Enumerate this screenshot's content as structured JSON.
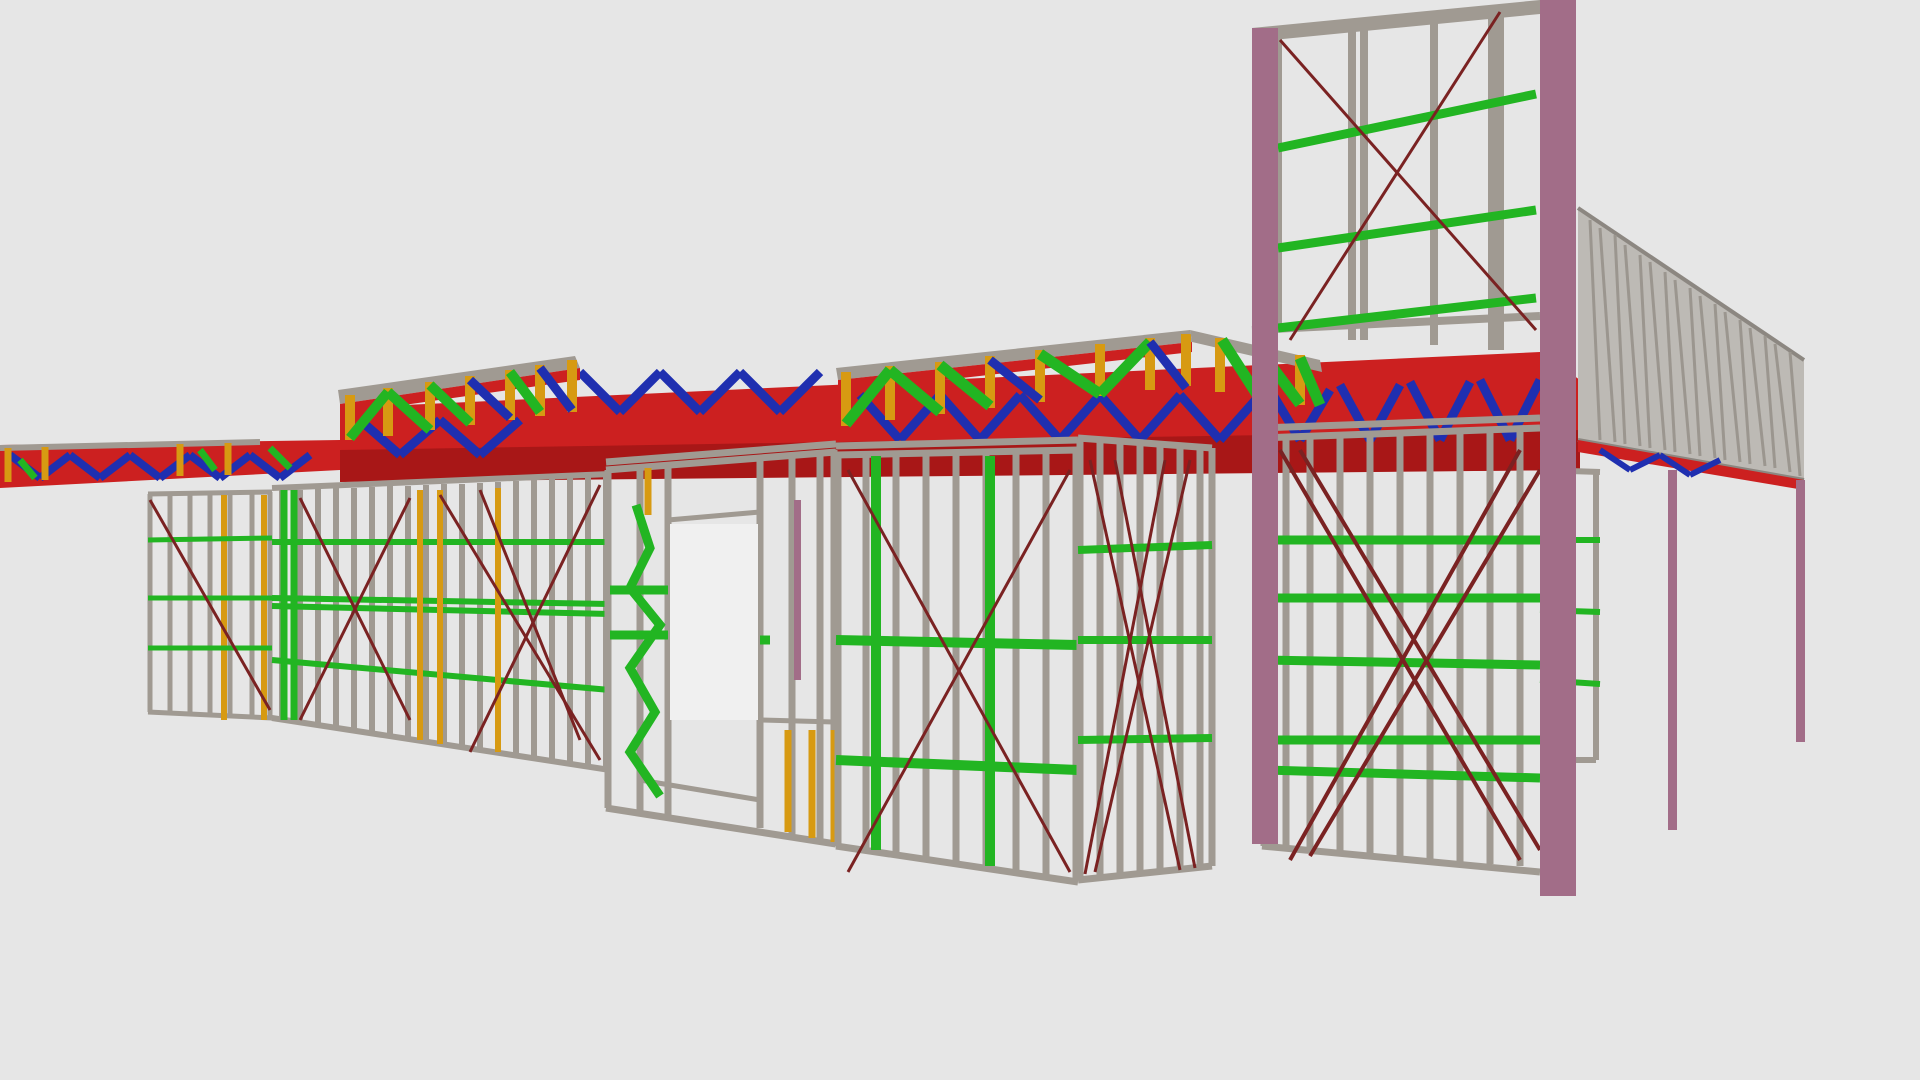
{
  "scene": {
    "background": "#e6e6e6",
    "member_colors": {
      "stud": "#a09a92",
      "stud_dark": "#7f7a73",
      "nogging": "#22b522",
      "brace": "#7a2222",
      "joist": "#d21f1f",
      "truss_web": "#1f2fb0",
      "truss_chord": "#d79a12",
      "column": "#a26d88"
    }
  }
}
